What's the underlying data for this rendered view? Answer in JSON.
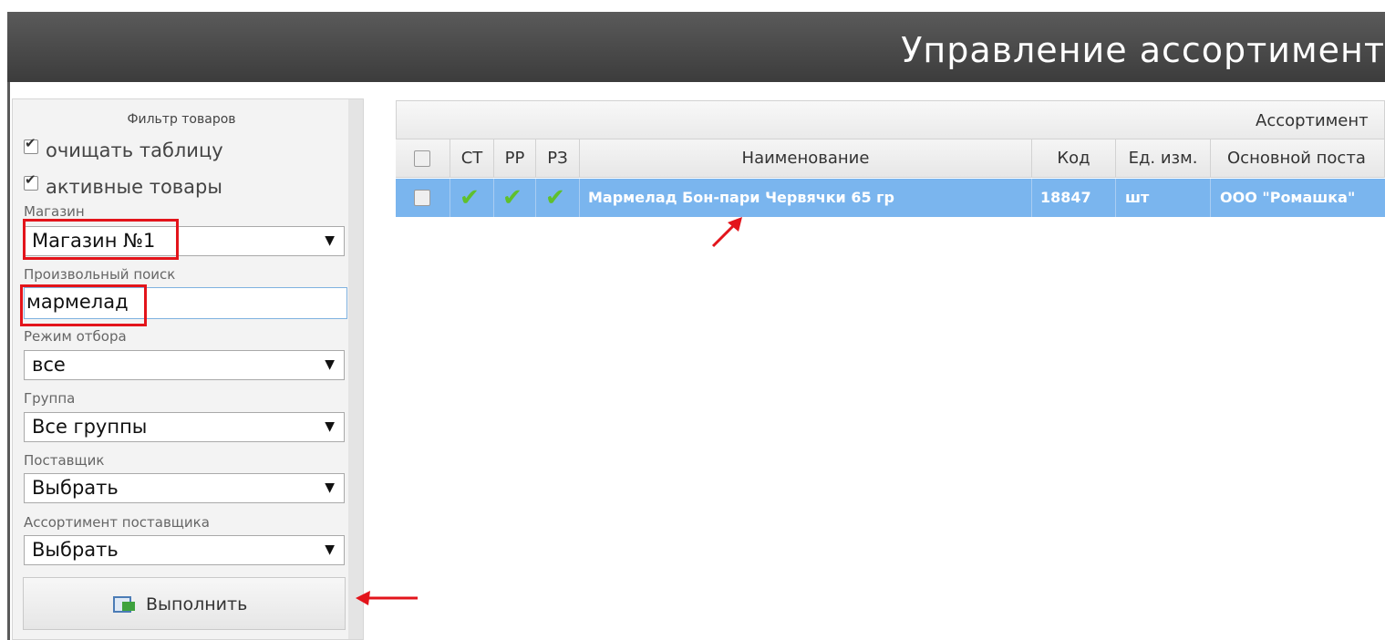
{
  "header": {
    "title": "Управление ассортимент"
  },
  "filter": {
    "title": "Фильтр товаров",
    "check_clear": {
      "label": "очищать таблицу",
      "checked": true
    },
    "check_active": {
      "label": "активные товары",
      "checked": true
    },
    "store": {
      "label": "Магазин",
      "value": "Магазин №1"
    },
    "search": {
      "label": "Произвольный поиск",
      "value": "мармелад"
    },
    "mode": {
      "label": "Режим отбора",
      "value": "все"
    },
    "group": {
      "label": "Группа",
      "value": "Все группы"
    },
    "supplier": {
      "label": "Поставщик",
      "value": "Выбрать"
    },
    "supplier_assortment": {
      "label": "Ассортимент поставщика",
      "value": "Выбрать"
    },
    "run_button": "Выполнить"
  },
  "grid": {
    "caption": "Ассортимент",
    "columns": [
      "СТ",
      "РР",
      "РЗ",
      "Наименование",
      "Код",
      "Ед. изм.",
      "Основной поста"
    ],
    "rows": [
      {
        "st": true,
        "rr": true,
        "rz": true,
        "name": "Мармелад Бон-пари Червячки 65 гр",
        "code": "18847",
        "unit": "шт",
        "supplier": "ООО \"Ромашка\""
      }
    ]
  },
  "colors": {
    "selected_row": "#7ab5ee",
    "highlight": "#e3141b",
    "check": "#5fc02c"
  }
}
